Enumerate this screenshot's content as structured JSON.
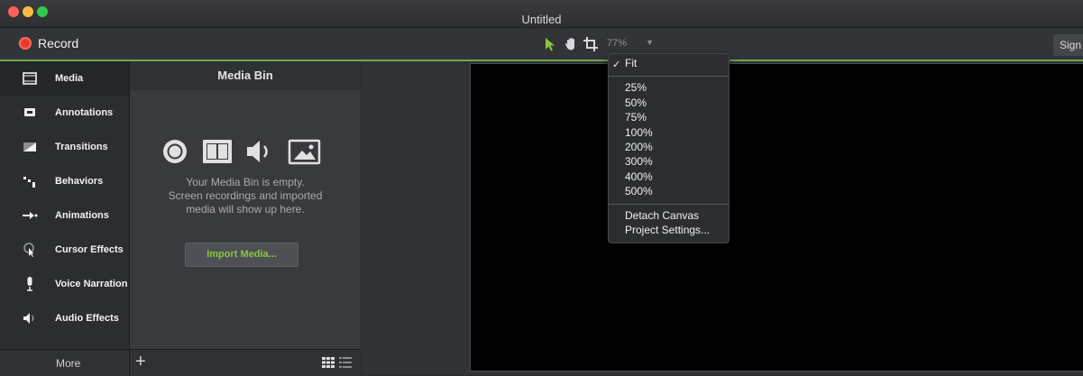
{
  "window": {
    "title": "Untitled"
  },
  "toolbar": {
    "record_label": "Record",
    "zoom_value": "77%",
    "sign_label": "Sign"
  },
  "sidebar": {
    "items": [
      {
        "label": "Media",
        "icon": "film-icon"
      },
      {
        "label": "Annotations",
        "icon": "annotation-icon"
      },
      {
        "label": "Transitions",
        "icon": "transition-icon"
      },
      {
        "label": "Behaviors",
        "icon": "behaviors-icon"
      },
      {
        "label": "Animations",
        "icon": "animation-arrow-icon"
      },
      {
        "label": "Cursor Effects",
        "icon": "cursor-icon"
      },
      {
        "label": "Voice Narration",
        "icon": "microphone-icon"
      },
      {
        "label": "Audio Effects",
        "icon": "speaker-icon"
      }
    ],
    "more_label": "More"
  },
  "media_bin": {
    "title": "Media Bin",
    "empty_line1": "Your Media Bin is empty.",
    "empty_line2": "Screen recordings and imported",
    "empty_line3": "media will show up here.",
    "import_label": "Import Media..."
  },
  "zoom_menu": {
    "fit": "Fit",
    "levels": [
      "25%",
      "50%",
      "75%",
      "100%",
      "200%",
      "300%",
      "400%",
      "500%"
    ],
    "detach": "Detach Canvas",
    "settings": "Project Settings..."
  },
  "colors": {
    "accent": "#8cc63f",
    "record": "#e8392f"
  }
}
